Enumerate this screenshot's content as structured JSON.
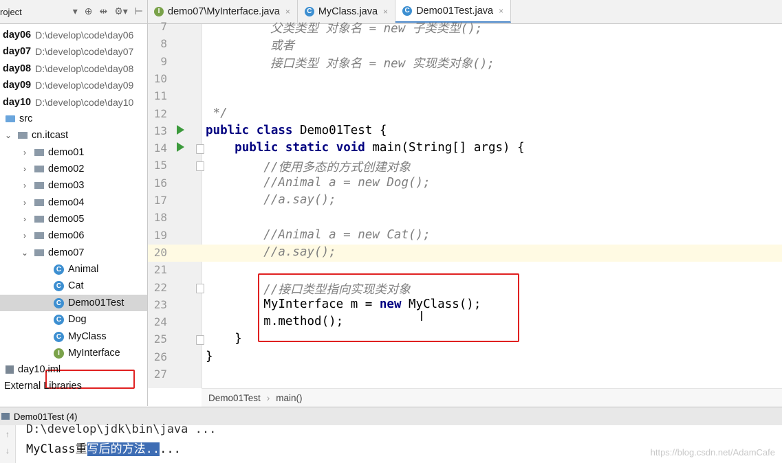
{
  "project_panel": {
    "title": "roject",
    "tools": [
      "▾",
      "⊕",
      "⇹",
      "⚙▾",
      "⊢"
    ]
  },
  "tabs": [
    {
      "icon": "I",
      "label": "demo07\\MyInterface.java",
      "close": "×"
    },
    {
      "icon": "C",
      "label": "MyClass.java",
      "close": "×"
    },
    {
      "icon": "C",
      "label": "Demo01Test.java",
      "close": "×"
    }
  ],
  "tree": {
    "modules": [
      {
        "name": "day06",
        "path": "D:\\develop\\code\\day06"
      },
      {
        "name": "day07",
        "path": "D:\\develop\\code\\day07"
      },
      {
        "name": "day08",
        "path": "D:\\develop\\code\\day08"
      },
      {
        "name": "day09",
        "path": "D:\\develop\\code\\day09"
      },
      {
        "name": "day10",
        "path": "D:\\develop\\code\\day10"
      }
    ],
    "src": "src",
    "package": "cn.itcast",
    "folders": [
      "demo01",
      "demo02",
      "demo03",
      "demo04",
      "demo05",
      "demo06",
      "demo07"
    ],
    "classes": [
      "Animal",
      "Cat",
      "Demo01Test",
      "Dog",
      "MyClass",
      "MyInterface"
    ],
    "iml": "day10.iml",
    "external": "External Libraries"
  },
  "editor": {
    "lines": [
      {
        "n": "7",
        "text": "父类类型 对象名 = new 子类类型();"
      },
      {
        "n": "8",
        "text": "或者"
      },
      {
        "n": "9",
        "text": "接口类型 对象名 = new 实现类对象();"
      },
      {
        "n": "10",
        "text": ""
      },
      {
        "n": "11",
        "text": ""
      },
      {
        "n": "12",
        "text": " */"
      },
      {
        "n": "13",
        "text": "public class Demo01Test {"
      },
      {
        "n": "14",
        "text": "    public static void main(String[] args) {"
      },
      {
        "n": "15",
        "text": "        //使用多态的方式创建对象"
      },
      {
        "n": "16",
        "text": "        //Animal a = new Dog();"
      },
      {
        "n": "17",
        "text": "        //a.say();"
      },
      {
        "n": "18",
        "text": ""
      },
      {
        "n": "19",
        "text": "        //Animal a = new Cat();"
      },
      {
        "n": "20",
        "text": "        //a.say();"
      },
      {
        "n": "21",
        "text": ""
      },
      {
        "n": "22",
        "text": "        //接口类型指向实现类对象"
      },
      {
        "n": "23",
        "text": "        MyInterface m = new MyClass();"
      },
      {
        "n": "24",
        "text": "        m.method();"
      },
      {
        "n": "25",
        "text": "    }"
      },
      {
        "n": "26",
        "text": "}"
      },
      {
        "n": "27",
        "text": ""
      }
    ],
    "current_line": "20"
  },
  "breadcrumb": {
    "class": "Demo01Test",
    "sep": "›",
    "method": "main()"
  },
  "run": {
    "label": "Demo01Test (4)",
    "line1": "D:\\develop\\jdk\\bin\\java ...",
    "line2_prefix": "MyClass重",
    "line2_selected": "写后的方法..",
    "line2_suffix": "..."
  },
  "watermark": "https://blog.csdn.net/AdamCafe"
}
